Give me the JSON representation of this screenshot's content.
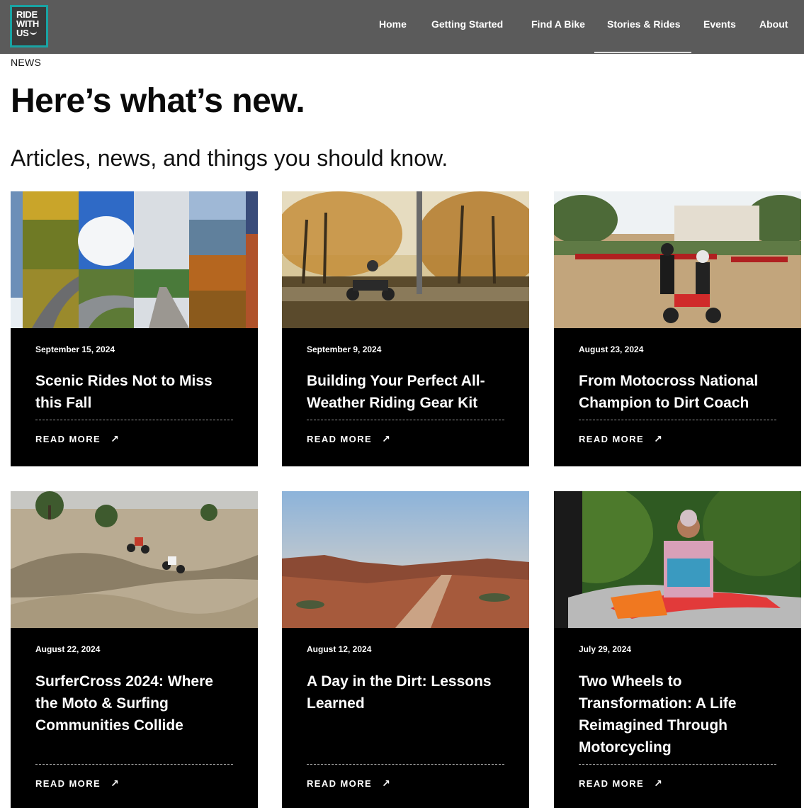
{
  "brand": {
    "logo_lines": [
      "RIDE",
      "WITH",
      "US"
    ],
    "accent": "#19a3a3"
  },
  "nav": {
    "items": [
      {
        "label": "Home"
      },
      {
        "label": "Getting Started"
      },
      {
        "label": "Find A Bike"
      },
      {
        "label": "Stories & Rides",
        "active": true
      },
      {
        "label": "Events"
      },
      {
        "label": "About"
      }
    ]
  },
  "page": {
    "eyebrow": "NEWS",
    "headline": "Here’s what’s new.",
    "subhead": "Articles, news, and things you should know."
  },
  "cards": [
    {
      "date": "September 15, 2024",
      "title": "Scenic Rides Not to Miss this Fall",
      "link": "READ MORE",
      "image": "autumn-road-collage"
    },
    {
      "date": "September 9, 2024",
      "title": "Building Your Perfect All-Weather Riding Gear Kit",
      "link": "READ MORE",
      "image": "rider-autumn-trees"
    },
    {
      "date": "August 23, 2024",
      "title": "From Motocross National Champion to Dirt Coach",
      "link": "READ MORE",
      "image": "dirt-coach-kids"
    },
    {
      "date": "August 22, 2024",
      "title": "SurferCross 2024: Where the Moto & Surfing Communities Collide",
      "link": "READ MORE",
      "image": "motocross-track"
    },
    {
      "date": "August 12, 2024",
      "title": "A Day in the Dirt: Lessons Learned",
      "link": "READ MORE",
      "image": "red-desert-trail"
    },
    {
      "date": "July 29, 2024",
      "title": "Two Wheels to Transformation: A Life Reimagined Through Motorcycling",
      "link": "READ MORE",
      "image": "rider-with-bike"
    }
  ]
}
